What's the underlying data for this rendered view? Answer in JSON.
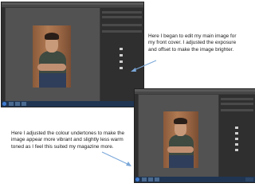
{
  "slides": [
    {
      "caption": "Here I began to edit my main image for my front cover. I adjusted the exposure and offset to make the image brighter."
    },
    {
      "caption": "Here I adjusted the colour undertones to make the image appear more vibrant and slightly less warm toned as I feel this suited my magazine more."
    }
  ],
  "colors": {
    "ps_bg": "#3a3a3a",
    "canvas": "#525252",
    "panel": "#2f2f2f",
    "taskbar": "#1f3552",
    "arrow": "#7aa7d9"
  }
}
